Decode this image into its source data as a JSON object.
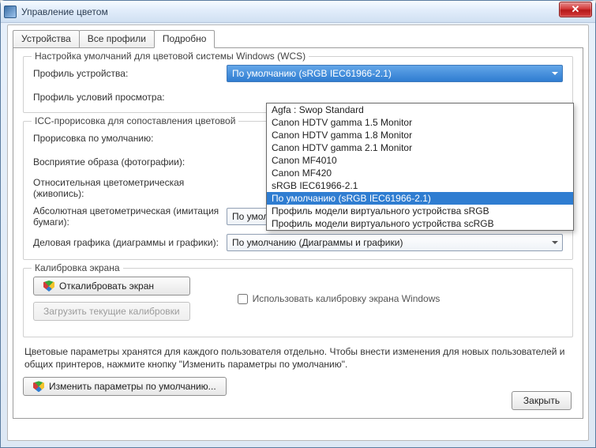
{
  "window": {
    "title": "Управление цветом"
  },
  "tabs": {
    "devices": "Устройства",
    "all_profiles": "Все профили",
    "advanced": "Подробно"
  },
  "wcs": {
    "legend": "Настройка умолчаний для цветовой системы Windows (WCS)",
    "device_profile_label": "Профиль устройства:",
    "device_profile_value": "По умолчанию (sRGB IEC61966-2.1)",
    "view_cond_label": "Профиль условий просмотра:",
    "options": [
      "Agfa : Swop Standard",
      "Canon HDTV gamma 1.5 Monitor",
      "Canon HDTV gamma 1.8 Monitor",
      "Canon HDTV gamma 2.1 Monitor",
      "Canon MF4010",
      "Canon MF420",
      "sRGB IEC61966-2.1",
      "По умолчанию (sRGB IEC61966-2.1)",
      "Профиль модели виртуального устройства sRGB",
      "Профиль модели виртуального устройства scRGB"
    ]
  },
  "icc": {
    "legend": "ICC-прорисовка для сопоставления цветовой",
    "default_render_label": "Прорисовка по умолчанию:",
    "perceptual_label": "Восприятие образа (фотографии):",
    "relative_label": "Относительная цветометрическая (живопись):",
    "absolute_label": "Абсолютная цветометрическая (имитация бумаги):",
    "absolute_value": "По умолчанию (Получение пробного изображения - имитация цве",
    "business_label": "Деловая графика (диаграммы и графики):",
    "business_value": "По умолчанию (Диаграммы и графики)"
  },
  "calib": {
    "legend": "Калибровка экрана",
    "calibrate_btn": "Откалибровать экран",
    "load_btn": "Загрузить текущие калибровки",
    "use_checkbox": "Использовать калибровку экрана Windows"
  },
  "footer": {
    "text": "Цветовые параметры хранятся для каждого пользователя отдельно. Чтобы внести изменения для новых пользователей и общих принтеров, нажмите кнопку \"Изменить параметры по умолчанию\".",
    "change_defaults_btn": "Изменить параметры по умолчанию...",
    "close_btn": "Закрыть"
  }
}
